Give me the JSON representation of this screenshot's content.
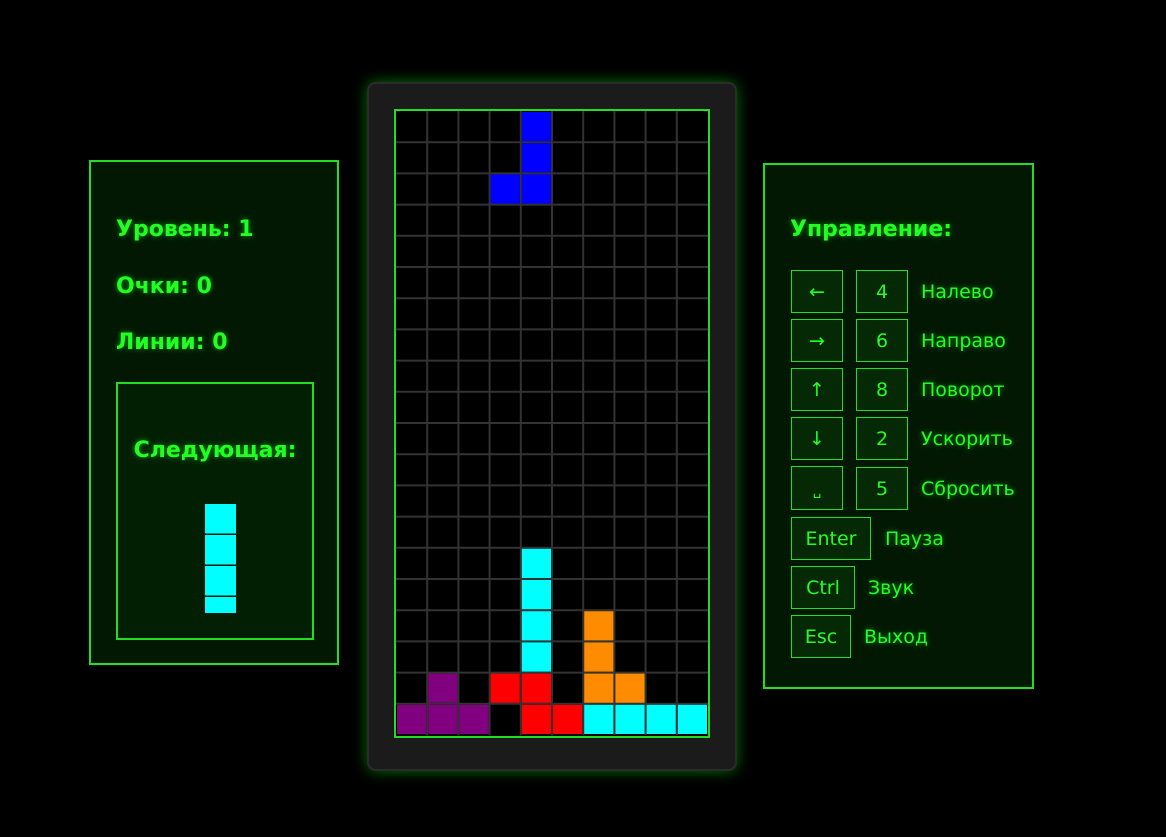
{
  "stats": {
    "level_label": "Уровень:",
    "level_value": "1",
    "score_label": "Очки:",
    "score_value": "0",
    "lines_label": "Линии:",
    "lines_value": "0"
  },
  "next_piece": {
    "title": "Следующая:",
    "shape": "I",
    "color": "#00ffff"
  },
  "colors": {
    "accent": "#22ff22",
    "cyan": "#00ffff",
    "blue": "#0000ff",
    "red": "#ff0000",
    "orange": "#ff8c00",
    "purple": "#800080"
  },
  "board": {
    "columns": 10,
    "rows": 20,
    "active_piece": {
      "shape": "J",
      "color": "#0000ff",
      "cells": [
        [
          4,
          0
        ],
        [
          4,
          1
        ],
        [
          3,
          2
        ],
        [
          4,
          2
        ]
      ]
    },
    "locked_cells": [
      {
        "c": 4,
        "r": 14,
        "color": "#00ffff"
      },
      {
        "c": 4,
        "r": 15,
        "color": "#00ffff"
      },
      {
        "c": 4,
        "r": 16,
        "color": "#00ffff"
      },
      {
        "c": 4,
        "r": 17,
        "color": "#00ffff"
      },
      {
        "c": 6,
        "r": 16,
        "color": "#ff8c00"
      },
      {
        "c": 6,
        "r": 17,
        "color": "#ff8c00"
      },
      {
        "c": 6,
        "r": 18,
        "color": "#ff8c00"
      },
      {
        "c": 7,
        "r": 18,
        "color": "#ff8c00"
      },
      {
        "c": 1,
        "r": 18,
        "color": "#800080"
      },
      {
        "c": 0,
        "r": 19,
        "color": "#800080"
      },
      {
        "c": 1,
        "r": 19,
        "color": "#800080"
      },
      {
        "c": 2,
        "r": 19,
        "color": "#800080"
      },
      {
        "c": 3,
        "r": 18,
        "color": "#ff0000"
      },
      {
        "c": 4,
        "r": 18,
        "color": "#ff0000"
      },
      {
        "c": 4,
        "r": 19,
        "color": "#ff0000"
      },
      {
        "c": 5,
        "r": 19,
        "color": "#ff0000"
      },
      {
        "c": 6,
        "r": 19,
        "color": "#00ffff"
      },
      {
        "c": 7,
        "r": 19,
        "color": "#00ffff"
      },
      {
        "c": 8,
        "r": 19,
        "color": "#00ffff"
      },
      {
        "c": 9,
        "r": 19,
        "color": "#00ffff"
      }
    ]
  },
  "controls": {
    "title": "Управление:",
    "rows": [
      {
        "key": "←",
        "alt": "4",
        "action": "Налево"
      },
      {
        "key": "→",
        "alt": "6",
        "action": "Направо"
      },
      {
        "key": "↑",
        "alt": "8",
        "action": "Поворот"
      },
      {
        "key": "↓",
        "alt": "2",
        "action": "Ускорить"
      },
      {
        "key": "␣",
        "alt": "5",
        "action": "Сбросить"
      },
      {
        "key": "Enter",
        "action": "Пауза"
      },
      {
        "key": "Ctrl",
        "action": "Звук"
      },
      {
        "key": "Esc",
        "action": "Выход"
      }
    ]
  }
}
